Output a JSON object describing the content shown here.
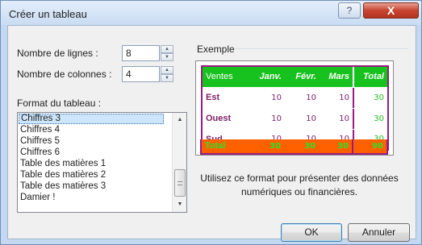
{
  "window": {
    "title": "Créer un tableau",
    "help_glyph": "?",
    "close_glyph": "X"
  },
  "rows_field": {
    "label": "Nombre de lignes :",
    "value": "8"
  },
  "cols_field": {
    "label": "Nombre de colonnes :",
    "value": "4"
  },
  "format": {
    "label": "Format du tableau :",
    "items": [
      "Chiffres 3",
      "Chiffres 4",
      "Chiffres 5",
      "Chiffres 6",
      "Table des matières 1",
      "Table des matières 2",
      "Table des matières 3",
      "Damier !"
    ],
    "selected": "Chiffres 3"
  },
  "preview": {
    "label": "Exemple",
    "header": [
      "Ventes",
      "Janv.",
      "Févr.",
      "Mars",
      "Total"
    ],
    "rows": [
      {
        "label": "Est",
        "values": [
          "10",
          "10",
          "10"
        ],
        "total": "30"
      },
      {
        "label": "Ouest",
        "values": [
          "10",
          "10",
          "10"
        ],
        "total": "30"
      },
      {
        "label": "Sud",
        "values": [
          "10",
          "10",
          "10"
        ],
        "total": "30"
      }
    ],
    "footer": {
      "label": "Total",
      "values": [
        "30",
        "30",
        "30"
      ],
      "total": "90"
    },
    "colors": {
      "header_bg": "#18c21e",
      "footer_bg": "#ff6100",
      "border": "#9a1a82",
      "label_text": "#7b1f69",
      "total_text": "#27c022"
    }
  },
  "description": "Utilisez ce format pour présenter des données numériques ou financières.",
  "buttons": {
    "ok": "OK",
    "cancel": "Annuler"
  },
  "icons": {
    "spin_up": "▲",
    "spin_down": "▼",
    "scroll_up": "▲",
    "scroll_down": "▼"
  }
}
